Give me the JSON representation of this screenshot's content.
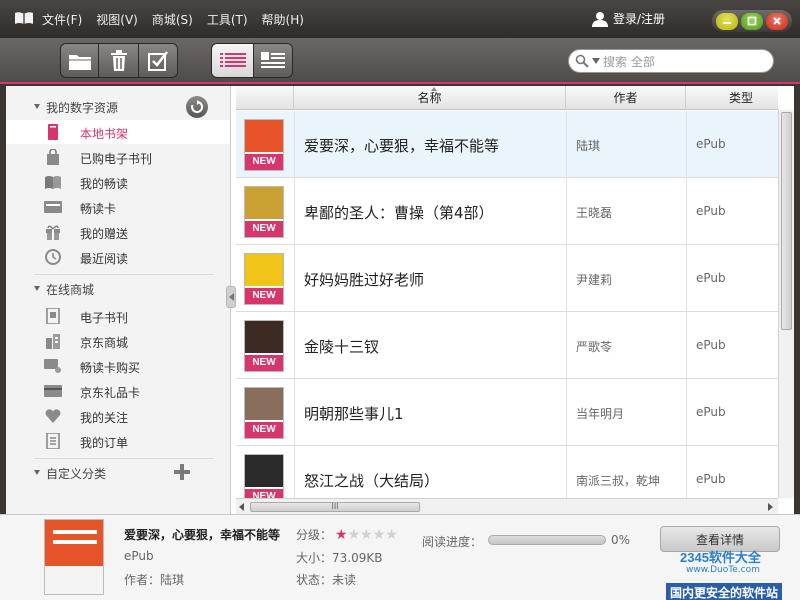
{
  "menu": [
    "文件(F)",
    "视图(V)",
    "商城(S)",
    "工具(T)",
    "帮助(H)"
  ],
  "login_label": "登录/注册",
  "search": {
    "placeholder": "搜索 全部"
  },
  "sidebar": {
    "my_resources": {
      "heading": "我的数字资源",
      "items": [
        {
          "label": "本地书架",
          "icon": "bookshelf-icon",
          "selected": true
        },
        {
          "label": "已购电子书刊",
          "icon": "bag-icon"
        },
        {
          "label": "我的畅读",
          "icon": "open-book-icon"
        },
        {
          "label": "畅读卡",
          "icon": "card-icon"
        },
        {
          "label": "我的赠送",
          "icon": "gift-icon"
        },
        {
          "label": "最近阅读",
          "icon": "clock-icon"
        }
      ]
    },
    "online_store": {
      "heading": "在线商城",
      "items": [
        {
          "label": "电子书刊",
          "icon": "ebook-icon"
        },
        {
          "label": "京东商城",
          "icon": "store-icon"
        },
        {
          "label": "畅读卡购买",
          "icon": "card-cart-icon"
        },
        {
          "label": "京东礼品卡",
          "icon": "giftcard-icon"
        },
        {
          "label": "我的关注",
          "icon": "heart-icon"
        },
        {
          "label": "我的订单",
          "icon": "order-icon"
        }
      ]
    },
    "custom": {
      "heading": "自定义分类"
    }
  },
  "table": {
    "headers": {
      "name": "名称",
      "author": "作者",
      "type": "类型"
    },
    "new_badge": "NEW",
    "rows": [
      {
        "title": "爱要深，心要狠，幸福不能等",
        "author": "陆琪",
        "type": "ePub",
        "cover_color": "#e8542a",
        "selected": true
      },
      {
        "title": "卑鄙的圣人：曹操（第4部）",
        "author": "王晓磊",
        "type": "ePub",
        "cover_color": "#c9a032"
      },
      {
        "title": "好妈妈胜过好老师",
        "author": "尹建莉",
        "type": "ePub",
        "cover_color": "#f0c419"
      },
      {
        "title": "金陵十三钗",
        "author": "严歌苓",
        "type": "ePub",
        "cover_color": "#3d2a22"
      },
      {
        "title": "明朝那些事儿1",
        "author": "当年明月",
        "type": "ePub",
        "cover_color": "#8a6e5c"
      },
      {
        "title": "怒江之战（大结局）",
        "author": "南派三叔，乾坤",
        "type": "ePub",
        "cover_color": "#2b2b2b"
      }
    ]
  },
  "hscroll_grip": "III",
  "info": {
    "title": "爱要深，心要狠，幸福不能等",
    "format": "ePub",
    "author_label": "作者：陆琪",
    "rating_label": "分级：",
    "rating": 1,
    "rating_max": 5,
    "size_label": "大小：73.09KB",
    "status_label": "状态：未读",
    "progress_label": "阅读进度：",
    "progress": 0,
    "progress_text": "0%",
    "detail_button": "查看详情"
  },
  "watermark": {
    "line1": "2345软件大全",
    "line2": "www.DuoTe.com",
    "line3": "国内更安全的软件站"
  },
  "colors": {
    "accent": "#d7356c",
    "titlebar": "#3a3634"
  }
}
